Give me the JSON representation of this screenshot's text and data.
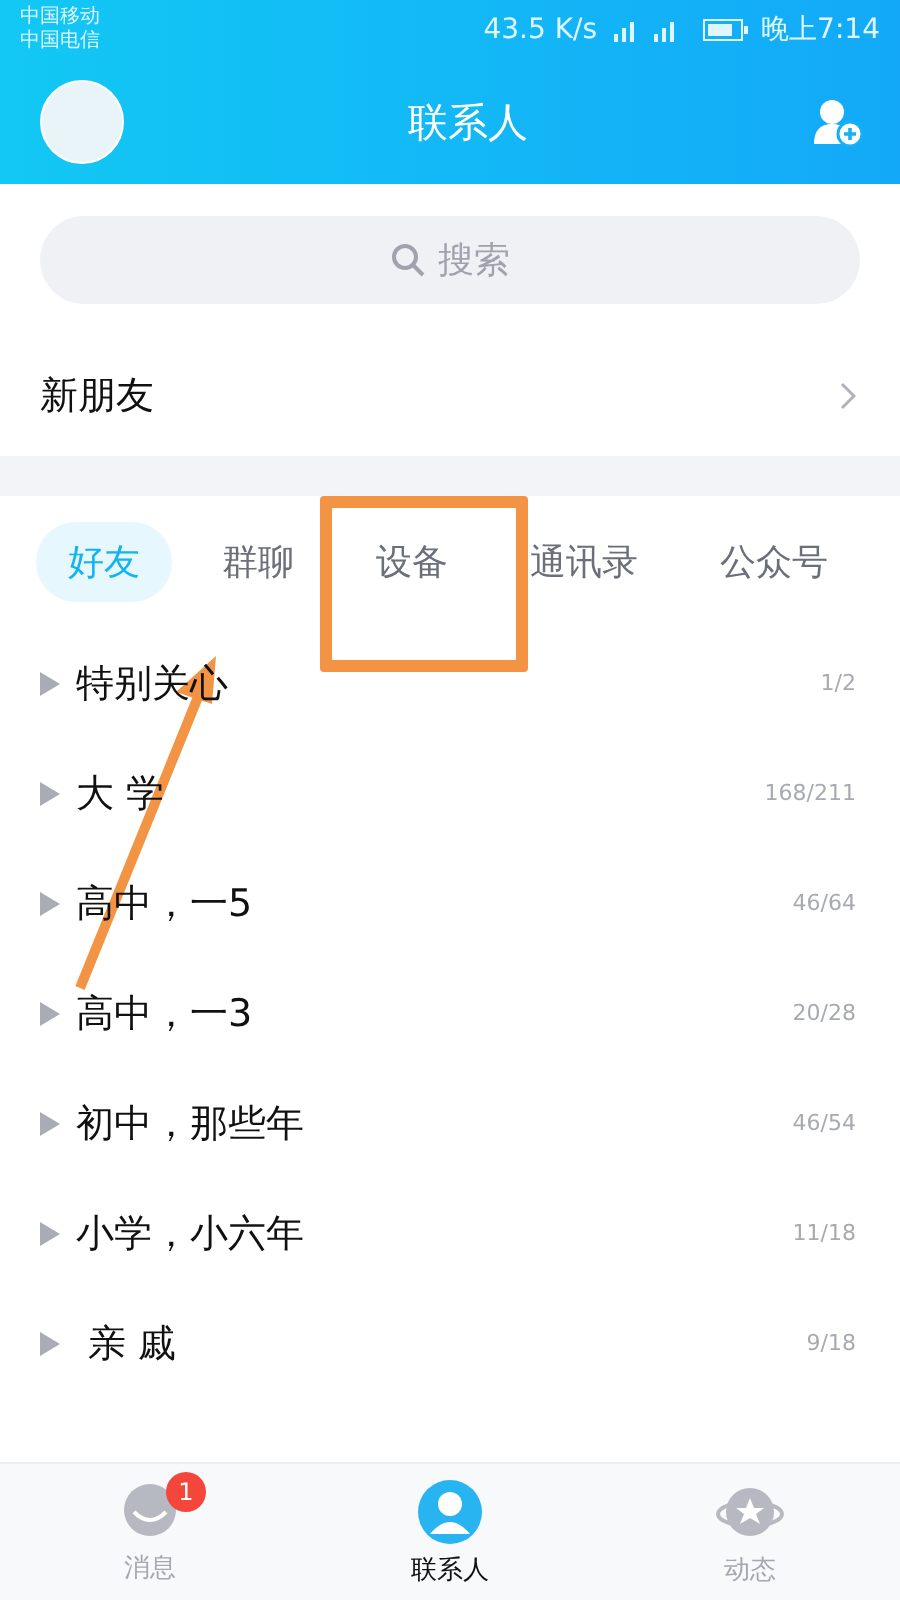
{
  "status_bar": {
    "carriers": [
      "中国移动",
      "中国电信"
    ],
    "speed": "43.5 K/s",
    "time": "晚上7:14"
  },
  "header": {
    "title": "联系人"
  },
  "search": {
    "placeholder": "搜索"
  },
  "new_friends": {
    "label": "新朋友"
  },
  "tabs": [
    {
      "label": "好友",
      "selected": true
    },
    {
      "label": "群聊",
      "selected": false
    },
    {
      "label": "设备",
      "selected": false
    },
    {
      "label": "通讯录",
      "selected": false
    },
    {
      "label": "公众号",
      "selected": false
    }
  ],
  "groups": [
    {
      "name": "特别关心",
      "count": "1/2"
    },
    {
      "name": "大 学",
      "count": "168/211"
    },
    {
      "name": "高中，一5",
      "count": "46/64"
    },
    {
      "name": "高中，一3",
      "count": "20/28"
    },
    {
      "name": "初中，那些年",
      "count": "46/54"
    },
    {
      "name": "小学，小六年",
      "count": "11/18"
    },
    {
      "name": " 亲 戚",
      "count": "9/18"
    }
  ],
  "bottom_nav": [
    {
      "label": "消息",
      "selected": false,
      "badge": "1"
    },
    {
      "label": "联系人",
      "selected": true
    },
    {
      "label": "动态",
      "selected": false
    }
  ]
}
